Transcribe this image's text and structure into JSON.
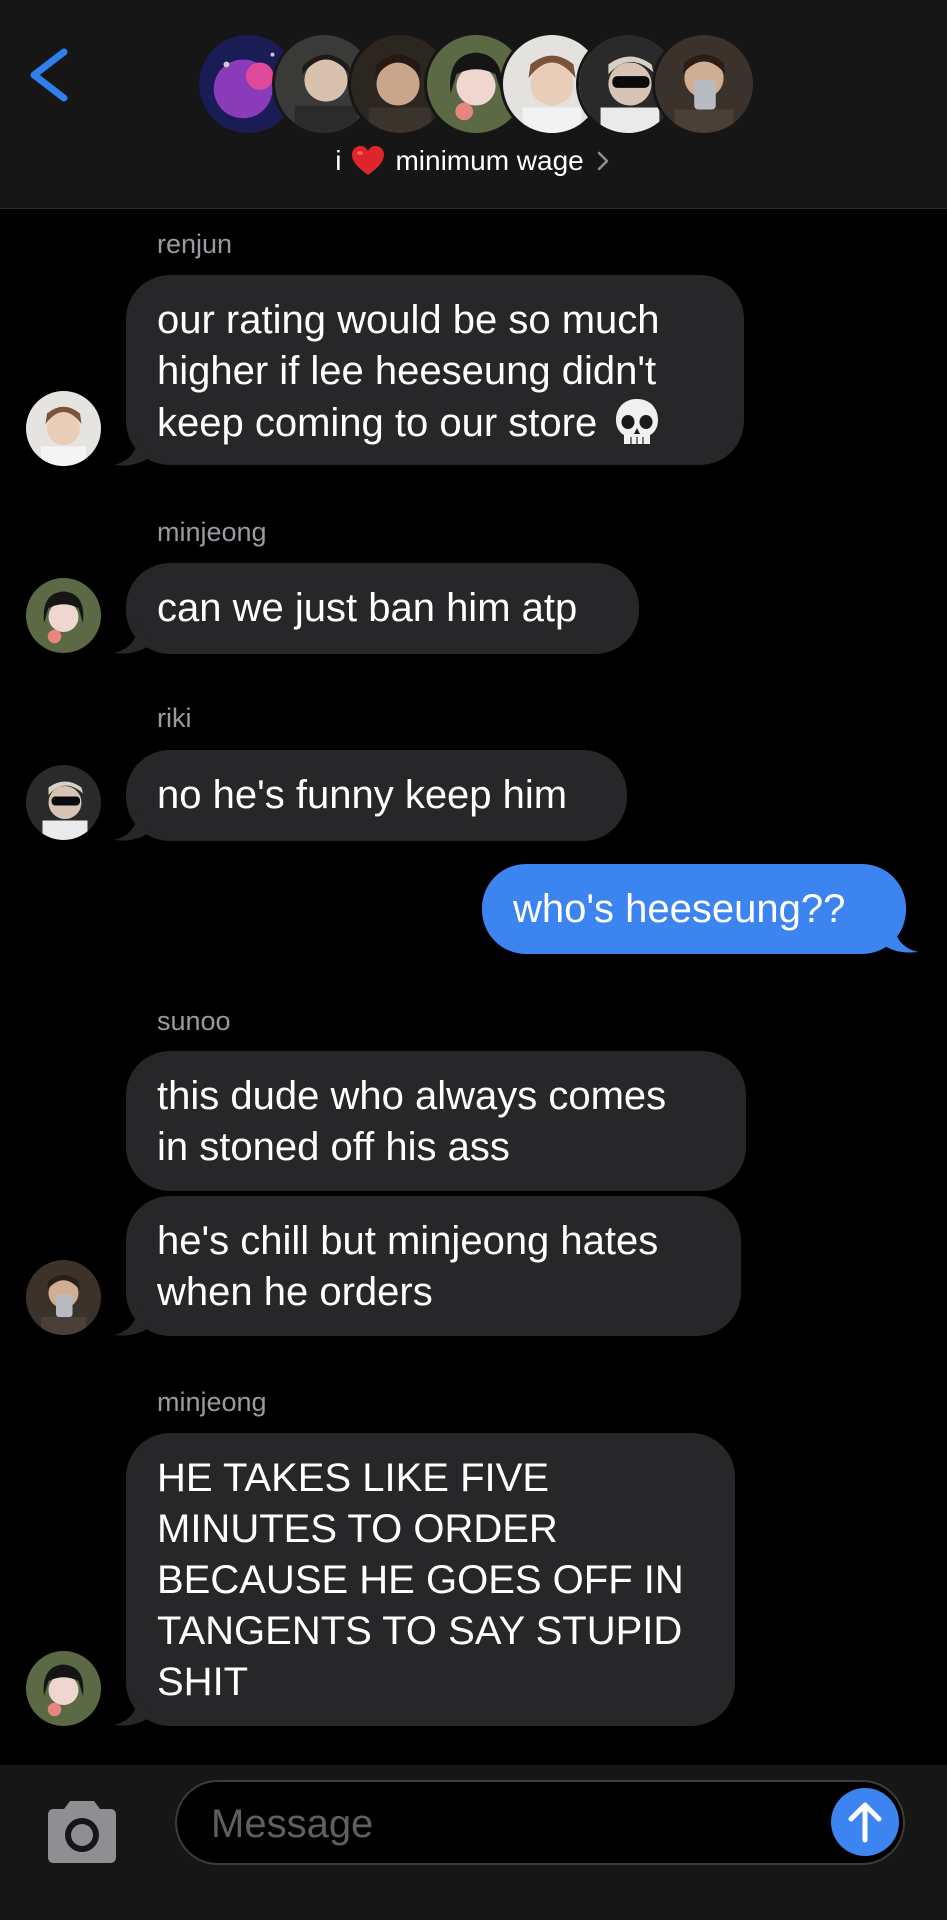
{
  "header": {
    "back_icon": "chevron-left-icon",
    "title_prefix": "i",
    "title_heart": "heart-emoji",
    "title_text": "minimum wage",
    "title_chevron": "chevron-right-icon",
    "participant_avatars": [
      "avatar-1",
      "avatar-2",
      "avatar-3",
      "avatar-4",
      "avatar-5",
      "avatar-6",
      "avatar-7"
    ]
  },
  "messages": [
    {
      "sender": "renjun",
      "lines": [
        "our rating would be so much",
        "higher if lee heeseung didn't",
        "keep coming to our store"
      ],
      "emoji": "skull-emoji"
    },
    {
      "sender": "minjeong",
      "lines": [
        "can we just ban him atp"
      ]
    },
    {
      "sender": "riki",
      "lines": [
        "no he's funny keep him"
      ]
    },
    {
      "sender": "me",
      "lines": [
        "who's heeseung??"
      ]
    },
    {
      "sender": "sunoo",
      "lines": [
        "this dude who always comes",
        "in stoned off his ass"
      ]
    },
    {
      "sender": "sunoo",
      "lines": [
        "he's chill but minjeong hates",
        "when he orders"
      ]
    },
    {
      "sender": "minjeong",
      "lines": [
        "HE TAKES LIKE FIVE",
        "MINUTES TO ORDER",
        "BECAUSE HE GOES OFF IN",
        "TANGENTS TO SAY STUPID",
        "SHIT"
      ]
    }
  ],
  "composer": {
    "placeholder": "Message",
    "camera_icon": "camera-icon",
    "send_icon": "send-arrow-icon"
  },
  "colors": {
    "background": "#000000",
    "header": "#161616",
    "incoming_bubble": "#27272a",
    "outgoing_bubble": "#3c84f0",
    "sender_text": "#9a9aa0",
    "accent": "#3c84f0"
  }
}
